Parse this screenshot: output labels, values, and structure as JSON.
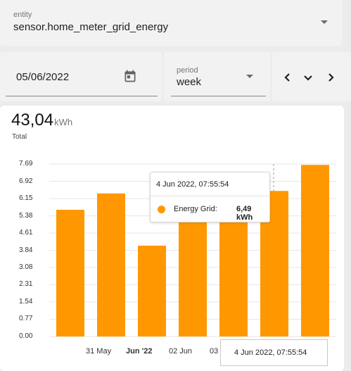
{
  "entity": {
    "label": "entity",
    "value": "sensor.home_meter_grid_energy"
  },
  "date": {
    "value": "05/06/2022"
  },
  "period": {
    "label": "period",
    "value": "week"
  },
  "nav": {
    "prev_icon": "chevron-left-icon",
    "down_icon": "chevron-down-icon",
    "next_icon": "chevron-right-icon"
  },
  "summary": {
    "value": "43,04",
    "unit": "kWh",
    "label": "Total"
  },
  "colors": {
    "bar": "#ff9800",
    "gridline": "#e6e6e6"
  },
  "chart_data": {
    "type": "bar",
    "y_ticks": [
      "7.69",
      "6.92",
      "6.15",
      "5.38",
      "4.61",
      "3.84",
      "3.08",
      "2.31",
      "1.54",
      "0.77",
      "0.00"
    ],
    "ylim": [
      0,
      7.69
    ],
    "x_tick_labels": [
      {
        "text": "31 May",
        "bold": false
      },
      {
        "text": "Jun '22",
        "bold": true
      },
      {
        "text": "02 Jun",
        "bold": false
      },
      {
        "text": "03",
        "bold": false
      }
    ],
    "series": [
      {
        "name": "Energy Grid",
        "values": [
          5.65,
          6.38,
          4.05,
          6.0,
          6.4,
          6.49,
          7.65
        ]
      }
    ],
    "tooltip": {
      "title": "4 Jun 2022, 07:55:54",
      "series_label": "Energy Grid:",
      "value": "6,49 kWh"
    },
    "axis_tooltip": "4 Jun 2022, 07:55:54"
  }
}
